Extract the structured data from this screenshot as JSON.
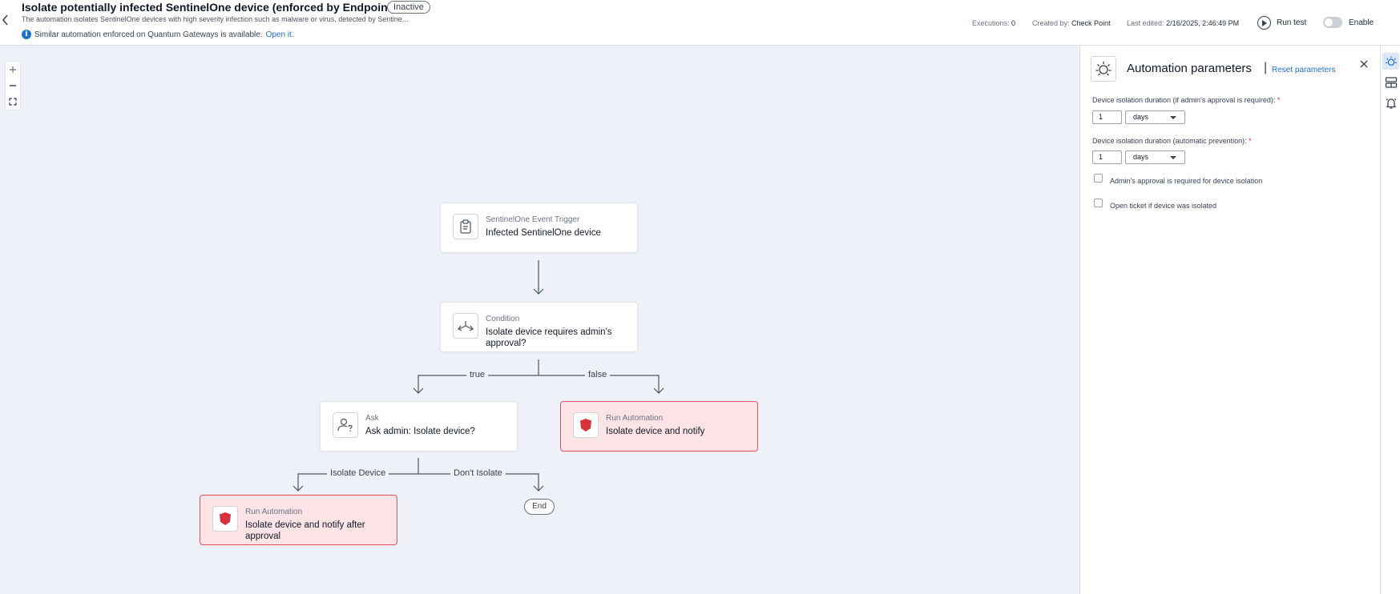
{
  "header": {
    "title": "Isolate potentially infected SentinelOne device (enforced by Endpoint)",
    "status": "Inactive",
    "description": "The automation isolates SentinelOne devices with high severity infection such as malware or virus, detected by Sentine...",
    "info_text": "Similar automation enforced on Quantum Gateways is available.",
    "info_link": "Open it.",
    "executions_label": "Executions:",
    "executions_value": "0",
    "created_label": "Created by:",
    "created_value": "Check Point",
    "edited_label": "Last edited:",
    "edited_value": "2/16/2025, 2:46:49 PM",
    "run_test_label": "Run test",
    "enable_label": "Enable",
    "enabled": false
  },
  "flow": {
    "nodes": [
      {
        "id": "trigger",
        "type": "SentinelOne Event Trigger",
        "name": "Infected SentinelOne device",
        "icon": "clipboard-icon"
      },
      {
        "id": "condition",
        "type": "Condition",
        "name": "Isolate device requires admin's approval?",
        "icon": "split-arrows-icon"
      },
      {
        "id": "ask",
        "type": "Ask",
        "name": "Ask admin: Isolate device?",
        "icon": "user-question-icon"
      },
      {
        "id": "run1",
        "type": "Run Automation",
        "name": "Isolate device and notify",
        "icon": "shield-icon"
      },
      {
        "id": "run2",
        "type": "Run Automation",
        "name": "Isolate device and notify after approval",
        "icon": "shield-icon"
      }
    ],
    "edge_labels": {
      "true": "true",
      "false": "false",
      "isolate": "Isolate Device",
      "dont_isolate": "Don't Isolate"
    },
    "end_label": "End"
  },
  "panel": {
    "title": "Automation parameters",
    "separator": "|",
    "reset_label": "Reset parameters",
    "fields": [
      {
        "label": "Device isolation duration (if admin's approval is required):",
        "required_mark": "*",
        "value": "1",
        "unit": "days"
      },
      {
        "label": "Device isolation duration (automatic prevention):",
        "required_mark": "*",
        "value": "1",
        "unit": "days"
      }
    ],
    "checkboxes": [
      {
        "label": "Admin's approval is required for device isolation",
        "checked": false
      },
      {
        "label": "Open ticket if device was isolated",
        "checked": false
      }
    ]
  },
  "colors": {
    "accent": "#1f6fd1",
    "danger": "#e4545f",
    "danger_bg": "#fce4e6",
    "canvas_bg": "#eef1f7"
  }
}
